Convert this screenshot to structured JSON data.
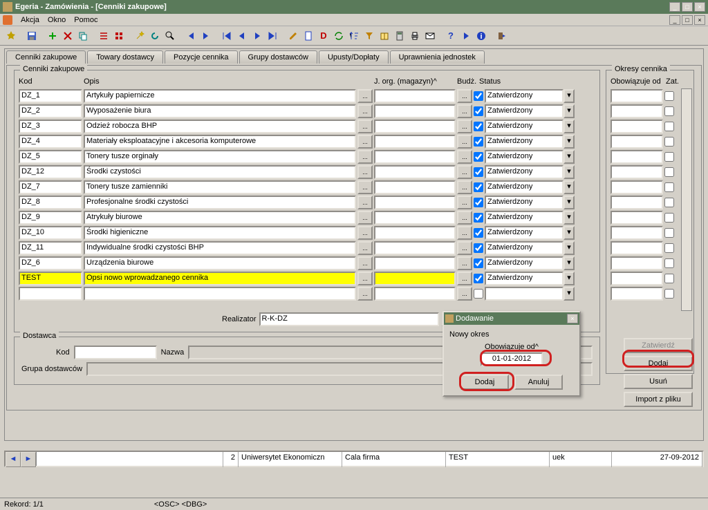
{
  "window": {
    "title": "Egeria - Zamówienia - [Cenniki zakupowe]"
  },
  "menu": {
    "items": [
      "Akcja",
      "Okno",
      "Pomoc"
    ]
  },
  "tabs": {
    "items": [
      "Cenniki zakupowe",
      "Towary dostawcy",
      "Pozycje cennika",
      "Grupy dostawców",
      "Upusty/Dopłaty",
      "Uprawnienia jednostek"
    ],
    "active": 0
  },
  "grid": {
    "title": "Cenniki zakupowe",
    "headers": {
      "kod": "Kod",
      "opis": "Opis",
      "jorg": "J. org. (magazyn)^",
      "budz": "Budż.",
      "status": "Status"
    },
    "status_value": "Zatwierdzony",
    "rows": [
      {
        "kod": "DZ_1",
        "opis": "Artykuły papiernicze"
      },
      {
        "kod": "DZ_2",
        "opis": "Wyposażenie biura"
      },
      {
        "kod": "DZ_3",
        "opis": "Odzież robocza BHP"
      },
      {
        "kod": "DZ_4",
        "opis": "Materiały eksploatacyjne i akcesoria komputerowe"
      },
      {
        "kod": "DZ_5",
        "opis": "Tonery tusze orginały"
      },
      {
        "kod": "DZ_12",
        "opis": "Środki czystości"
      },
      {
        "kod": "DZ_7",
        "opis": "Tonery tusze zamienniki"
      },
      {
        "kod": "DZ_8",
        "opis": "Profesjonalne środki czystości"
      },
      {
        "kod": "DZ_9",
        "opis": "Atrykuły biurowe"
      },
      {
        "kod": "DZ_10",
        "opis": "Środki higieniczne"
      },
      {
        "kod": "DZ_11",
        "opis": "Indywidualne środki czystości BHP"
      },
      {
        "kod": "DZ_6",
        "opis": "Urządzenia biurowe"
      }
    ],
    "highlighted": {
      "kod": "TEST",
      "opis": "Opsi nowo wprowadzanego cennika"
    },
    "realizator_label": "Realizator",
    "realizator_value": "R-K-DZ"
  },
  "dostawca": {
    "title": "Dostawca",
    "kod_label": "Kod",
    "nazwa_label": "Nazwa",
    "grupa_label": "Grupa dostawców"
  },
  "okresy": {
    "title": "Okresy cennika",
    "header_date": "Obowiązuje od",
    "header_zat": "Zat."
  },
  "side_buttons": {
    "zatwierdz": "Zatwierdź",
    "dodaj": "Dodaj",
    "usun": "Usuń",
    "import": "Import z pliku"
  },
  "dialog": {
    "title": "Dodawanie",
    "label1": "Nowy okres",
    "label2": "Obowiązuje od^",
    "date_value": "01-01-2012",
    "btn_ok": "Dodaj",
    "btn_cancel": "Anuluj"
  },
  "status_grid": {
    "col2": "2",
    "col3": "Uniwersytet Ekonomiczn",
    "col4": "Cala firma",
    "col5": "TEST",
    "col6": "uek",
    "col7": "27-09-2012"
  },
  "statusbar": {
    "rekord": "Rekord: 1/1",
    "osc": "<OSC>",
    "dbg": "<DBG>"
  }
}
